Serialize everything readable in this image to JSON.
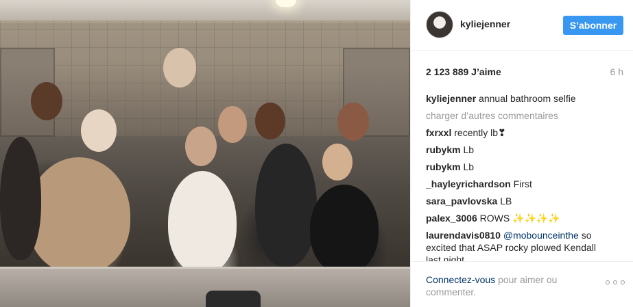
{
  "post": {
    "photo_icon": "photo"
  },
  "header": {
    "username": "kyliejenner",
    "avatar_icon": "profile-photo",
    "follow_label": "S’abonner",
    "follow_color": "#3897f0"
  },
  "stats": {
    "likes": "2 123 889 J’aime",
    "time": "6 h"
  },
  "caption": {
    "user": "kyliejenner",
    "text": "annual bathroom selfie"
  },
  "load_more_label": "charger d’autres commentaires",
  "comments": [
    {
      "user": "fxrxxl",
      "text": "recently lb❣"
    },
    {
      "user": "rubykm",
      "text": "Lb"
    },
    {
      "user": "rubykm",
      "text": "Lb"
    },
    {
      "user": "_hayleyrichardson",
      "text": "First"
    },
    {
      "user": "sara_pavlovska",
      "text": "LB"
    },
    {
      "user": "palex_3006",
      "text": "ROWS ✨✨✨✨"
    },
    {
      "user": "laurendavis0810",
      "mention": "@mobounceinthe",
      "text": "so excited that ASAP rocky plowed Kendall last night"
    }
  ],
  "footer": {
    "login_link": "Connectez-vous",
    "login_text": "pour aimer ou commenter.",
    "more_icon": "more-options"
  }
}
